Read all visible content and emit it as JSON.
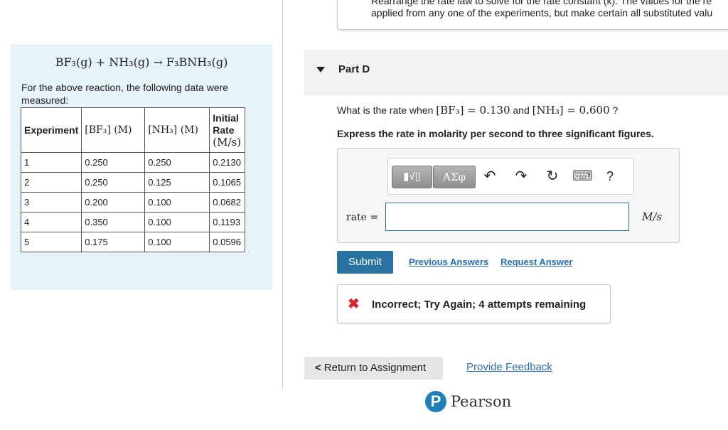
{
  "hint": {
    "line1": "Rearrange the rate law to solve for the rate constant (k). The values for the re",
    "line2": "applied from any one of the experiments, but make certain all substituted valu"
  },
  "reaction": {
    "equation": "BF₃(g) + NH₃(g) → F₃BNH₃(g)",
    "intro": "For the above reaction, the following data were measured:"
  },
  "table": {
    "headers": [
      "Experiment",
      "[BF₃] (M)",
      "[NH₃] (M)",
      "Initial Rate",
      "(M/s)"
    ],
    "rows": [
      [
        "1",
        "0.250",
        "0.250",
        "0.2130"
      ],
      [
        "2",
        "0.250",
        "0.125",
        "0.1065"
      ],
      [
        "3",
        "0.200",
        "0.100",
        "0.0682"
      ],
      [
        "4",
        "0.350",
        "0.100",
        "0.1193"
      ],
      [
        "5",
        "0.175",
        "0.100",
        "0.0596"
      ]
    ]
  },
  "part": {
    "title": "Part D"
  },
  "question": {
    "prefix": "What is the rate when ",
    "bf3": "[BF₃] = 0.130",
    "and": " and ",
    "nh3": "[NH₃] = 0.600",
    "suffix": " ?",
    "instruction": "Express the rate in molarity per second to three significant figures."
  },
  "answer": {
    "toolbar": {
      "templates": "▮√▯",
      "greek": "ΑΣφ",
      "undo": "↶",
      "redo": "↷",
      "reset": "↻",
      "keyboard": "⌨",
      "help": "?"
    },
    "label": "rate =",
    "value": "",
    "unit": "M/s"
  },
  "actions": {
    "submit": "Submit",
    "previous_answers": "Previous Answers",
    "request_answer": "Request Answer"
  },
  "feedback": {
    "icon": "✖",
    "text": "Incorrect; Try Again; 4 attempts remaining"
  },
  "footer": {
    "return": "Return to Assignment",
    "return_icon": "<",
    "provide_feedback": "Provide Feedback",
    "logo_letter": "P",
    "brand": "Pearson"
  },
  "colors": {
    "panel_bg": "#e6f3f8",
    "submit_bg": "#2a72a2",
    "link": "#2a6db0",
    "error": "#d6282a",
    "input_border": "#2e6da4",
    "brand_blue": "#1f7fb8"
  }
}
